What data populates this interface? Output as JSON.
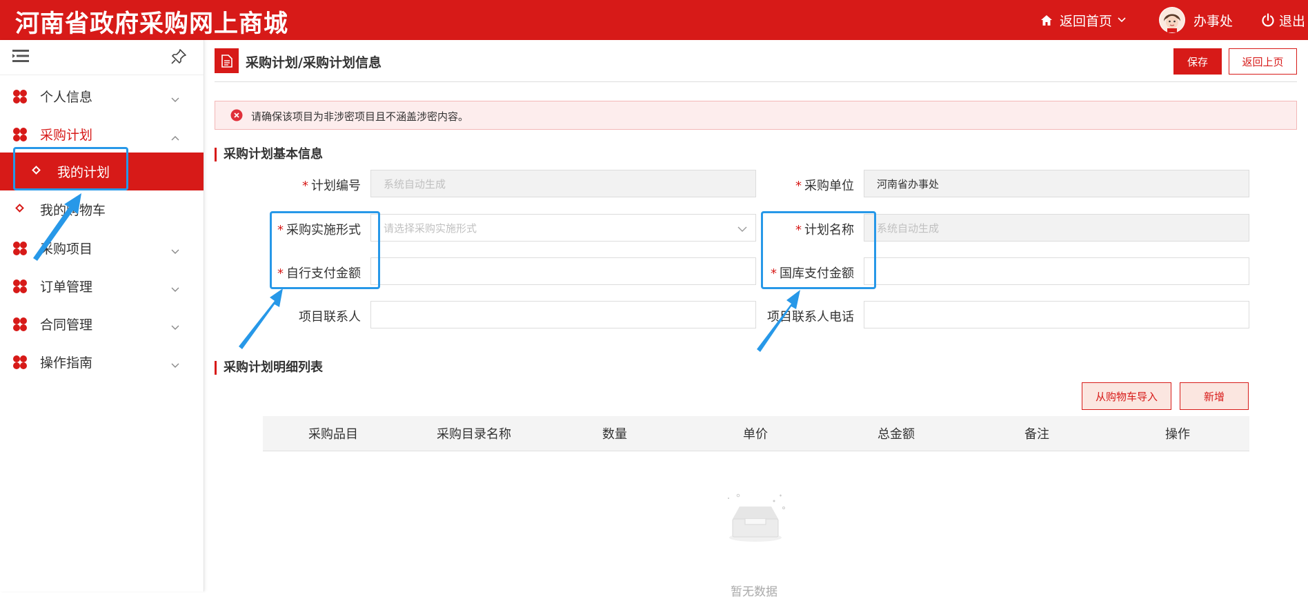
{
  "header": {
    "brand": "河南省政府采购网上商城",
    "home_label": "返回首页",
    "user_label": "办事处",
    "logout_label": "退出"
  },
  "sidebar": {
    "items": [
      {
        "label": "个人信息",
        "icon": "clover-icon"
      },
      {
        "label": "采购计划",
        "icon": "clover-icon"
      },
      {
        "label": "我的计划",
        "icon": "diamond-icon"
      },
      {
        "label": "我的购物车",
        "icon": "diamond-icon"
      },
      {
        "label": "采购项目",
        "icon": "clover-icon"
      },
      {
        "label": "订单管理",
        "icon": "clover-icon"
      },
      {
        "label": "合同管理",
        "icon": "clover-icon"
      },
      {
        "label": "操作指南",
        "icon": "clover-icon"
      }
    ]
  },
  "page": {
    "title": "采购计划/采购计划信息",
    "save_label": "保存",
    "back_label": "返回上页",
    "alert": "请确保该项目为非涉密项目且不涵盖涉密内容。"
  },
  "basic": {
    "title": "采购计划基本信息",
    "fields": {
      "plan_no": {
        "label": "计划编号",
        "placeholder": "系统自动生成"
      },
      "unit": {
        "label": "采购单位",
        "value": "河南省办事处"
      },
      "method": {
        "label": "采购实施形式",
        "placeholder": "请选择采购实施形式"
      },
      "plan_name": {
        "label": "计划名称",
        "placeholder": "系统自动生成"
      },
      "self_pay": {
        "label": "自行支付金额",
        "value": ""
      },
      "treasury_pay": {
        "label": "国库支付金额",
        "value": ""
      },
      "contact": {
        "label": "项目联系人",
        "value": ""
      },
      "contact_phone": {
        "label": "项目联系人电话",
        "value": ""
      }
    }
  },
  "detail": {
    "title": "采购计划明细列表",
    "import_label": "从购物车导入",
    "add_label": "新增",
    "columns": [
      "采购品目",
      "采购目录名称",
      "数量",
      "单价",
      "总金额",
      "备注",
      "操作"
    ],
    "empty_text": "暂无数据"
  },
  "colors": {
    "brand_red": "#d71a18",
    "annotation_blue": "#2798e8"
  }
}
